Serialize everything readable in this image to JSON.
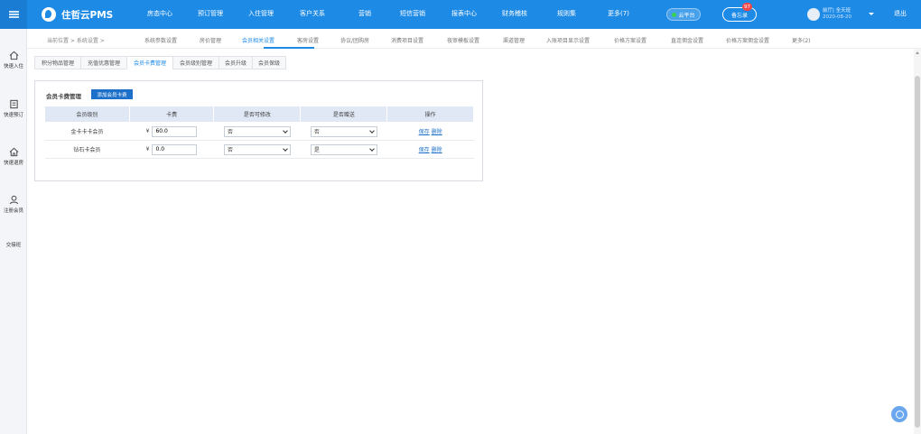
{
  "header": {
    "brand": "住哲云PMS",
    "nav": [
      "房态中心",
      "预订管理",
      "入住管理",
      "客户关系",
      "营销",
      "短信营销",
      "报表中心",
      "财务稽核",
      "规则集",
      "更多(7)"
    ],
    "cloud_label": "云平台",
    "memo_label": "备忘录",
    "memo_badge": "97",
    "user_name": "前厅| 全天班",
    "user_date": "2020-08-20",
    "logout": "退出"
  },
  "sidebar": {
    "items": [
      {
        "label": "快速入住",
        "icon": "home-icon"
      },
      {
        "label": "快速预订",
        "icon": "booking-icon"
      },
      {
        "label": "快速退房",
        "icon": "checkout-icon"
      },
      {
        "label": "注册会员",
        "icon": "user-icon"
      },
      {
        "label": "交接班",
        "icon": "none"
      }
    ]
  },
  "breadcrumb": {
    "text": "当前位置 > 系统设置 >"
  },
  "subnav": [
    "系统参数设置",
    "房价管理",
    "会员相关设置",
    "客房设置",
    "协议/团购房",
    "消费项目设置",
    "夜审模板设置",
    "渠道管理",
    "入账项目显示设置",
    "价格方案设置",
    "直连佣金设置",
    "价格方案佣金设置",
    "更多(2)"
  ],
  "tabs": [
    "积分物品管理",
    "充值优惠管理",
    "会员卡费管理",
    "会员级别管理",
    "会员升级",
    "会员保级"
  ],
  "panel": {
    "title": "会员卡费管理",
    "add_button": "添加会员卡费",
    "columns": [
      "会员级别",
      "卡费",
      "是否可修改",
      "是否赠送",
      "操作"
    ],
    "rows": [
      {
        "level": "金卡卡卡会员",
        "fee": "60.0",
        "editable": "否",
        "gift": "否",
        "save": "保存",
        "delete": "删除"
      },
      {
        "level": "钻石卡会员",
        "fee": "0.0",
        "editable": "否",
        "gift": "是",
        "save": "保存",
        "delete": "删除"
      }
    ],
    "currency": "¥"
  },
  "colors": {
    "primary": "#1d8ae6",
    "button": "#1d70c9",
    "table_header": "#dfe8f4"
  }
}
